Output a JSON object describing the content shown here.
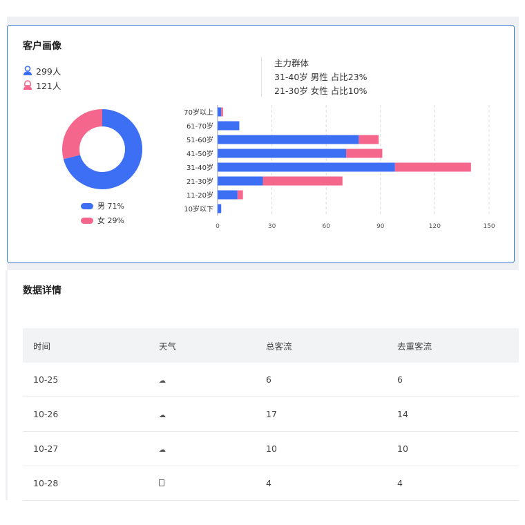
{
  "profile": {
    "title": "客户画像",
    "male_count": "299人",
    "female_count": "121人",
    "main_group_title": "主力群体",
    "main_group_line1": "31-40岁 男性 占比23%",
    "main_group_line2": "21-30岁 女性 占比10%",
    "legend_male": "男 71%",
    "legend_female": "女 29%",
    "colors": {
      "male": "#3d6ff5",
      "female": "#f4668c",
      "accent_border": "#3a7bd5"
    }
  },
  "chart_data": [
    {
      "type": "pie",
      "title": "",
      "labels": [
        "男",
        "女"
      ],
      "values": [
        71,
        29
      ],
      "colors": [
        "#3d6ff5",
        "#f4668c"
      ],
      "donut": true
    },
    {
      "type": "bar",
      "orientation": "horizontal",
      "stacked": true,
      "title": "",
      "categories": [
        "70岁以上",
        "61-70岁",
        "51-60岁",
        "41-50岁",
        "31-40岁",
        "21-30岁",
        "11-20岁",
        "10岁以下"
      ],
      "series": [
        {
          "color": "#3d6ff5",
          "values": [
            2,
            12,
            78,
            71,
            98,
            25,
            11,
            2
          ]
        },
        {
          "color": "#f4668c",
          "values": [
            1,
            0,
            11,
            20,
            42,
            44,
            3,
            0
          ]
        }
      ],
      "xlim": [
        0,
        150
      ],
      "xticks": [
        0,
        30,
        60,
        90,
        120,
        150
      ],
      "grid": "vertical-dashed"
    }
  ],
  "details": {
    "title": "数据详情",
    "headers": [
      "时间",
      "天气",
      "总客流",
      "去重客流"
    ],
    "rows": [
      {
        "time": "10-25",
        "weather_icon": "cloud-icon",
        "total": "6",
        "unique": "6"
      },
      {
        "time": "10-26",
        "weather_icon": "cloud-icon",
        "total": "17",
        "unique": "14"
      },
      {
        "time": "10-27",
        "weather_icon": "cloud-icon",
        "total": "10",
        "unique": "10"
      },
      {
        "time": "10-28",
        "weather_icon": "unknown-weather-icon",
        "total": "4",
        "unique": "4"
      }
    ]
  }
}
